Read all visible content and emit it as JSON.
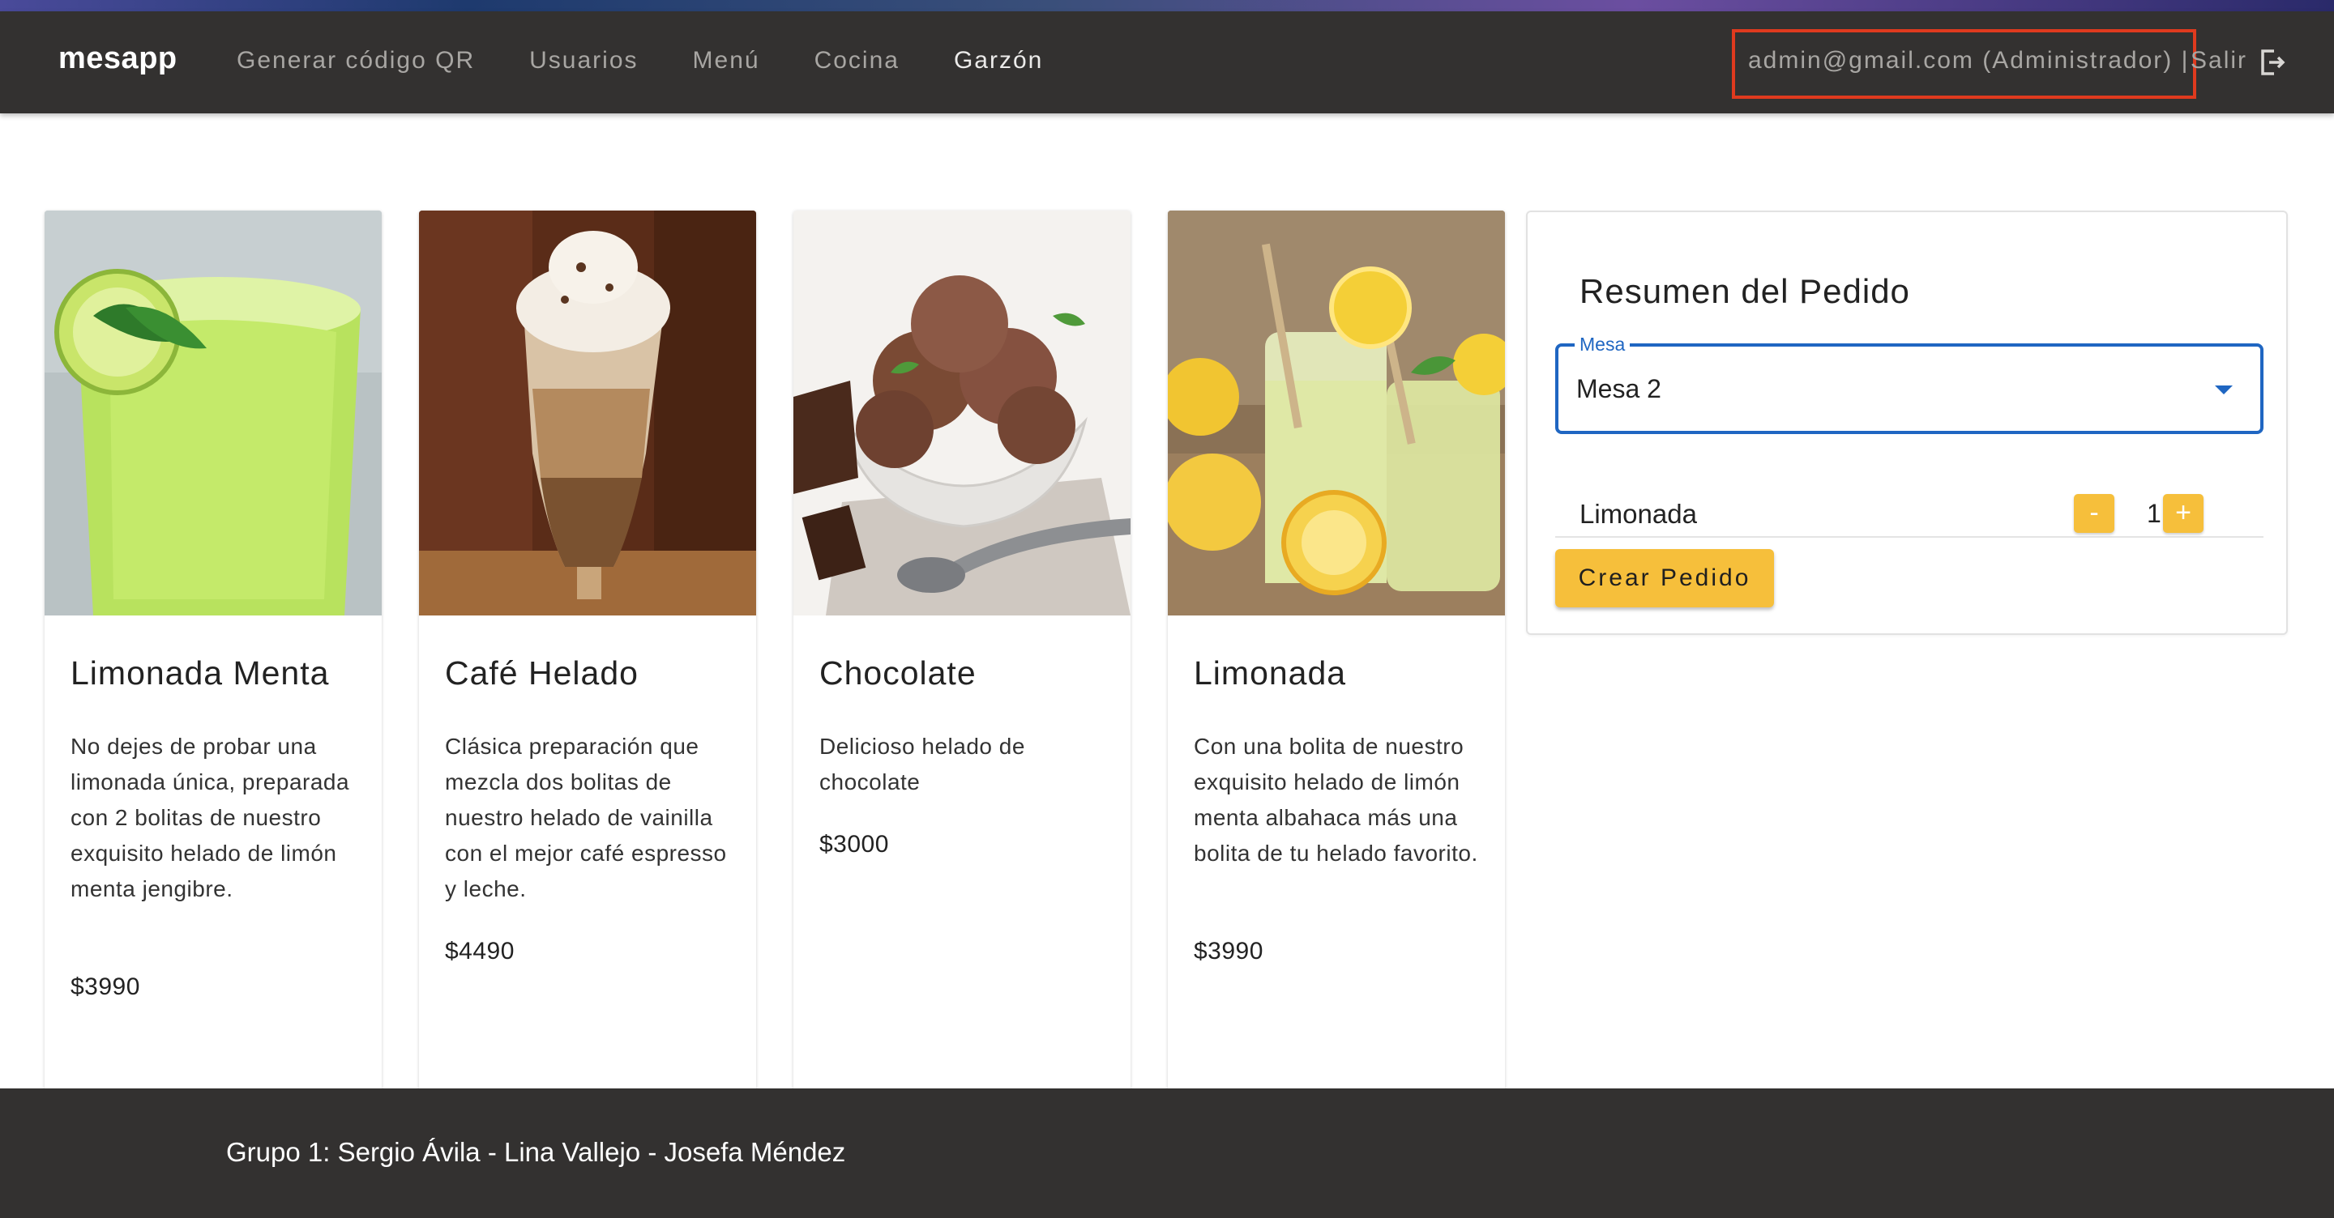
{
  "navbar": {
    "brand": "mesapp",
    "links": [
      "Generar código QR",
      "Usuarios",
      "Menú",
      "Cocina",
      "Garzón"
    ],
    "active_link": "Garzón",
    "user_info": "admin@gmail.com (Administrador) |",
    "logout_label": "Salir",
    "logout_icon": "logout-icon"
  },
  "products": [
    {
      "title": "Limonada Menta",
      "description": "No dejes de probar una limonada única, preparada con 2 bolitas de nuestro exquisito helado de limón menta jengibre.",
      "price": "$3990",
      "image": "lime-mint-drink-photo"
    },
    {
      "title": "Café Helado",
      "description": "Clásica preparación que mezcla dos bolitas de nuestro helado de vainilla con el mejor café espresso y leche.",
      "price": "$4490",
      "image": "iced-coffee-photo"
    },
    {
      "title": "Chocolate",
      "description": "Delicioso helado de chocolate",
      "price": "$3000",
      "image": "chocolate-ice-cream-photo"
    },
    {
      "title": "Limonada",
      "description": "Con una bolita de nuestro exquisito helado de limón menta albahaca más una bolita de tu helado favorito.",
      "price": "$3990",
      "image": "lemonade-photo"
    }
  ],
  "summary": {
    "title": "Resumen del Pedido",
    "mesa_label": "Mesa",
    "mesa_value": "Mesa 2",
    "items": [
      {
        "name": "Limonada",
        "quantity": "1"
      }
    ],
    "minus_label": "-",
    "plus_label": "+",
    "create_button": "Crear Pedido"
  },
  "footer": {
    "text": "Grupo 1: Sergio Ávila - Lina Vallejo - Josefa Méndez"
  },
  "colors": {
    "navbar_bg": "#333130",
    "accent_yellow": "#f6bf3b",
    "select_blue": "#1f66c2",
    "highlight_red": "#e03a1e"
  }
}
